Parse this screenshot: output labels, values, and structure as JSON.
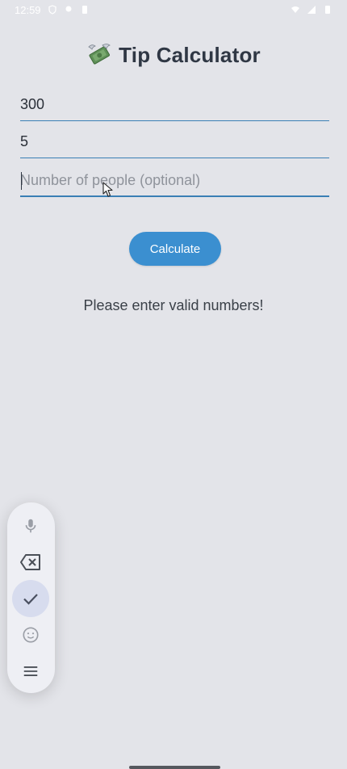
{
  "status_bar": {
    "time": "12:59"
  },
  "app": {
    "title": "Tip Calculator",
    "title_icon": "money-with-wings-icon"
  },
  "form": {
    "bill_amount": {
      "value": "300",
      "placeholder": ""
    },
    "tip_percent": {
      "value": "5",
      "placeholder": ""
    },
    "people": {
      "value": "",
      "placeholder": "Number of people (optional)"
    },
    "calculate_label": "Calculate"
  },
  "result": {
    "message": "Please enter valid numbers!"
  },
  "keyboard_toolbar": {
    "items": [
      "microphone-icon",
      "backspace-icon",
      "check-icon",
      "emoji-icon",
      "menu-icon"
    ]
  },
  "colors": {
    "background": "#e3e4e9",
    "accent": "#3b8fd0",
    "underline": "#3a7fb5"
  }
}
